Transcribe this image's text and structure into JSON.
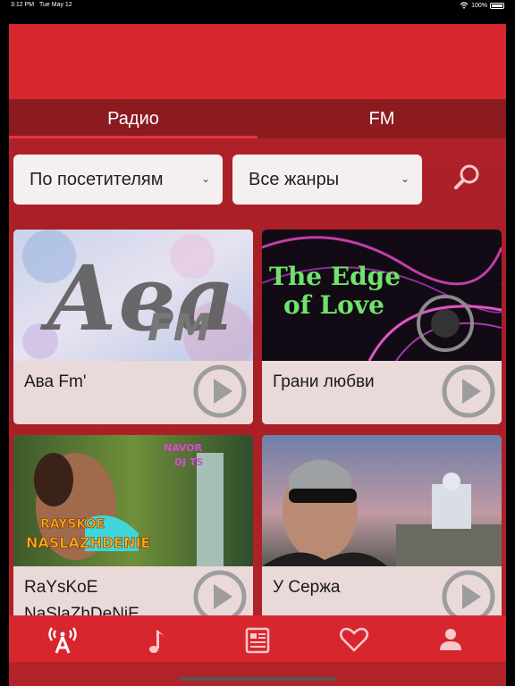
{
  "status_bar": {
    "time": "3:12 PM",
    "date": "Tue May 12",
    "battery": "100%"
  },
  "tabs": [
    {
      "label": "Радио",
      "active": true
    },
    {
      "label": "FM",
      "active": false
    }
  ],
  "filters": {
    "sort": "По посетителям",
    "genre": "Все жанры"
  },
  "stations": [
    {
      "title": "Ава Fm'",
      "art_text_1": "Ава",
      "art_text_2": "FM"
    },
    {
      "title": "Грани любви",
      "art_text_1": "The Edge",
      "art_text_2": "of Love"
    },
    {
      "title": "RaYsKoE NaSlaZhDeNiE",
      "art_text_1": "RAYSKOE",
      "art_text_2": "NASLAZHDENIE",
      "art_text_3": "NAVOR",
      "art_text_4": "DJ TS"
    },
    {
      "title": "У Сержа"
    }
  ],
  "bottom_nav": [
    {
      "name": "radio",
      "icon": "radio-tower-icon",
      "active": true
    },
    {
      "name": "music",
      "icon": "music-note-icon"
    },
    {
      "name": "news",
      "icon": "newspaper-icon"
    },
    {
      "name": "favorites",
      "icon": "heart-icon"
    },
    {
      "name": "profile",
      "icon": "user-icon"
    }
  ],
  "colors": {
    "primary": "#d8262f",
    "tab_bar": "#8c1b20",
    "background": "#a61e25",
    "card": "#ead9d9",
    "accent_light": "#f7c9cb"
  }
}
